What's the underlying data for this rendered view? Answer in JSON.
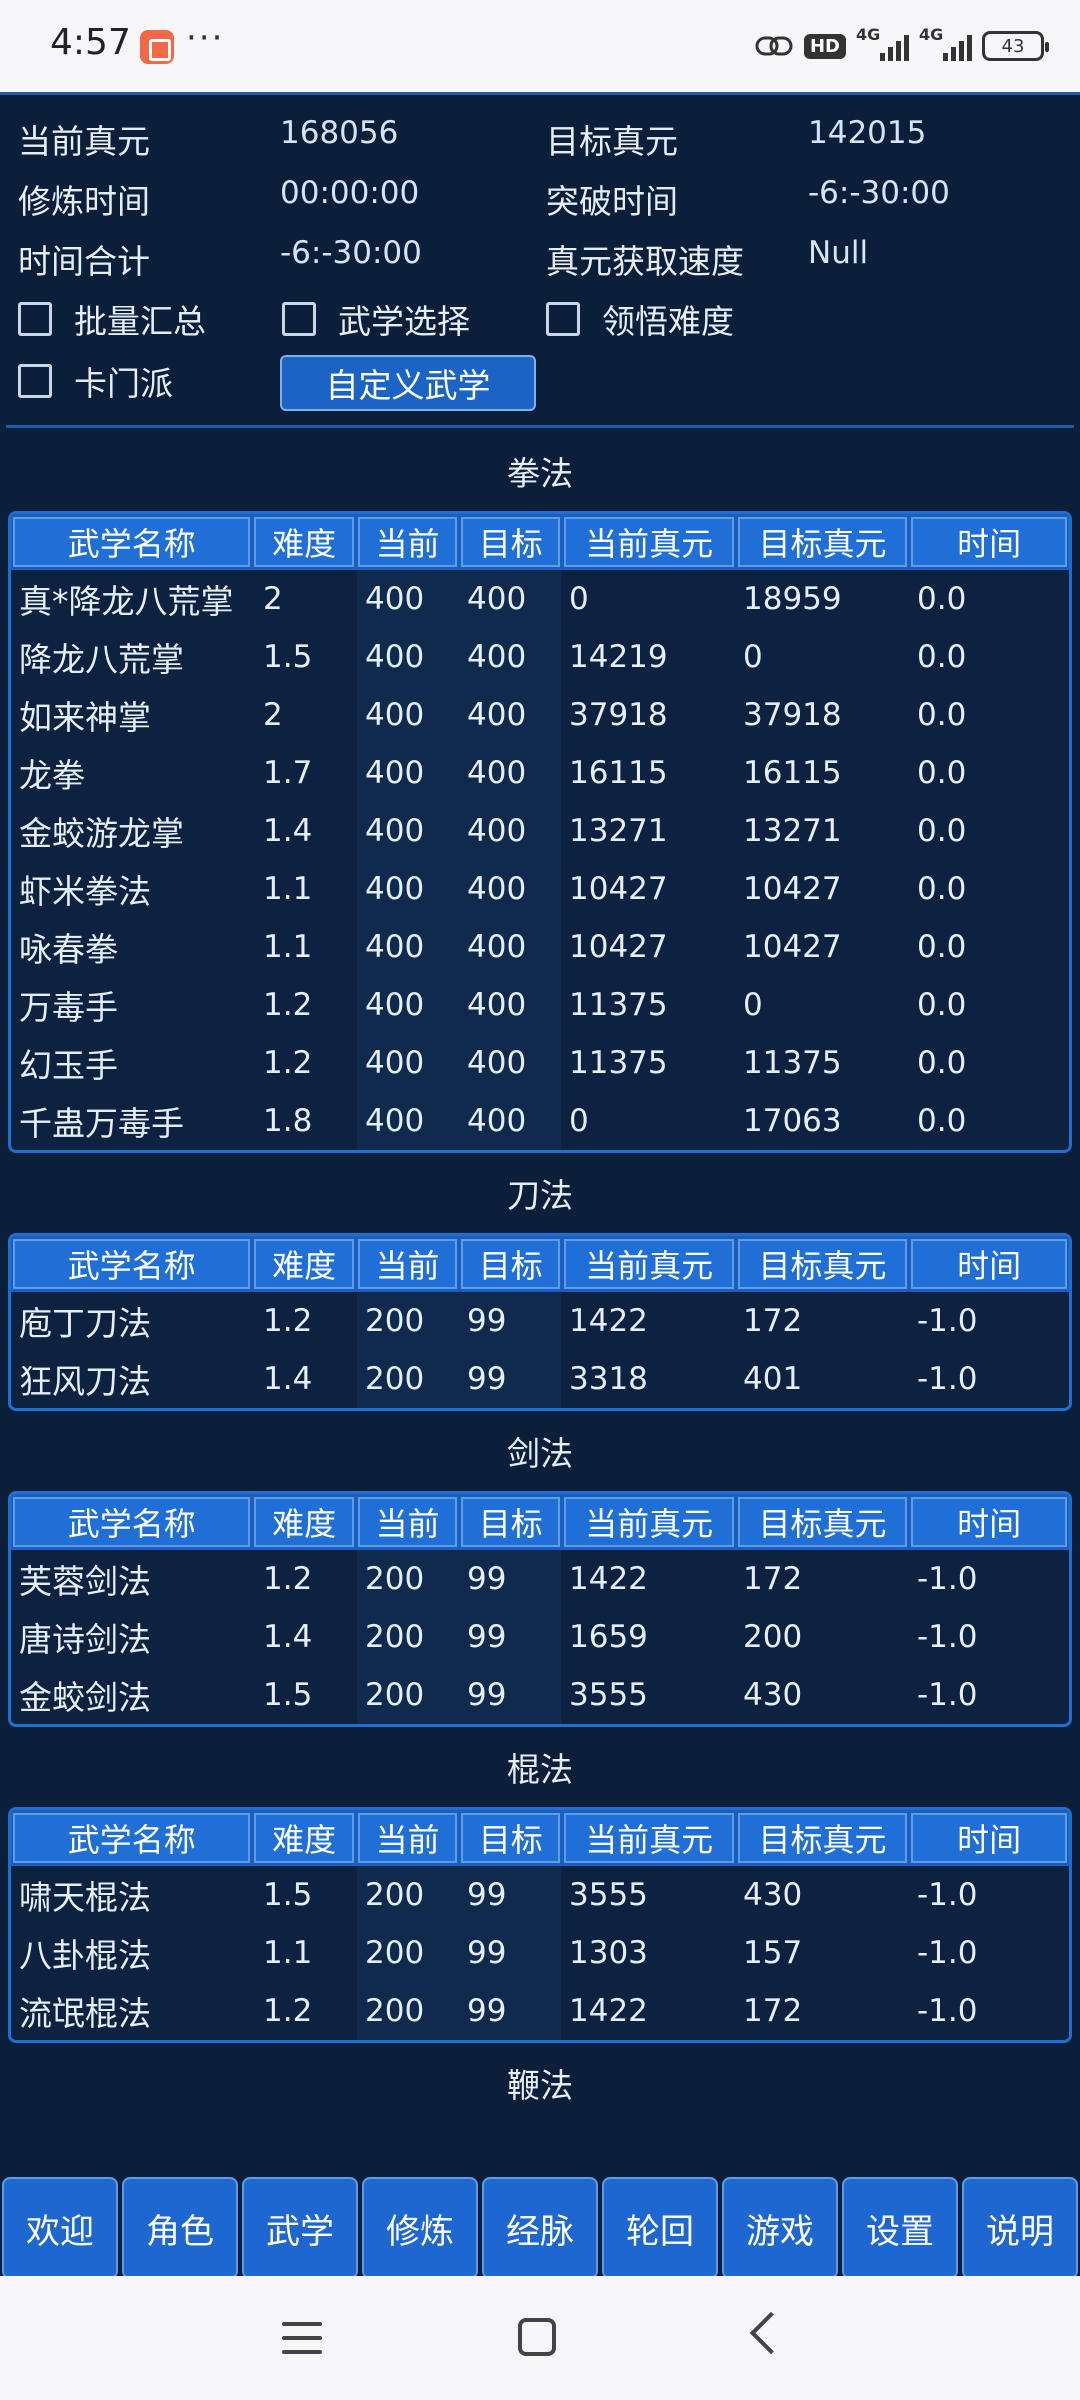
{
  "status": {
    "time": "4:57",
    "dots": "···",
    "hd": "HD",
    "net1": "4G",
    "net2": "4G",
    "battery": "43"
  },
  "summary": {
    "current_zy_label": "当前真元",
    "current_zy_value": "168056",
    "target_zy_label": "目标真元",
    "target_zy_value": "142015",
    "train_time_label": "修炼时间",
    "train_time_value": "00:00:00",
    "break_time_label": "突破时间",
    "break_time_value": "-6:-30:00",
    "total_time_label": "时间合计",
    "total_time_value": "-6:-30:00",
    "speed_label": "真元获取速度",
    "speed_value": "Null"
  },
  "checkboxes": {
    "batch": "批量汇总",
    "martial_select": "武学选择",
    "insight": "领悟难度",
    "sect": "卡门派"
  },
  "custom_button": "自定义武学",
  "headers": {
    "name": "武学名称",
    "difficulty": "难度",
    "current": "当前",
    "target": "目标",
    "cur_zy": "当前真元",
    "tgt_zy": "目标真元",
    "time": "时间"
  },
  "sections": [
    {
      "title": "拳法",
      "rows": [
        [
          "真*降龙八荒掌",
          "2",
          "400",
          "400",
          "0",
          "18959",
          "0.0"
        ],
        [
          "降龙八荒掌",
          "1.5",
          "400",
          "400",
          "14219",
          "0",
          "0.0"
        ],
        [
          "如来神掌",
          "2",
          "400",
          "400",
          "37918",
          "37918",
          "0.0"
        ],
        [
          "龙拳",
          "1.7",
          "400",
          "400",
          "16115",
          "16115",
          "0.0"
        ],
        [
          "金蛟游龙掌",
          "1.4",
          "400",
          "400",
          "13271",
          "13271",
          "0.0"
        ],
        [
          "虾米拳法",
          "1.1",
          "400",
          "400",
          "10427",
          "10427",
          "0.0"
        ],
        [
          "咏春拳",
          "1.1",
          "400",
          "400",
          "10427",
          "10427",
          "0.0"
        ],
        [
          "万毒手",
          "1.2",
          "400",
          "400",
          "11375",
          "0",
          "0.0"
        ],
        [
          "幻玉手",
          "1.2",
          "400",
          "400",
          "11375",
          "11375",
          "0.0"
        ],
        [
          "千蛊万毒手",
          "1.8",
          "400",
          "400",
          "0",
          "17063",
          "0.0"
        ]
      ]
    },
    {
      "title": "刀法",
      "rows": [
        [
          "庖丁刀法",
          "1.2",
          "200",
          "99",
          "1422",
          "172",
          "-1.0"
        ],
        [
          "狂风刀法",
          "1.4",
          "200",
          "99",
          "3318",
          "401",
          "-1.0"
        ]
      ]
    },
    {
      "title": "剑法",
      "rows": [
        [
          "芙蓉剑法",
          "1.2",
          "200",
          "99",
          "1422",
          "172",
          "-1.0"
        ],
        [
          "唐诗剑法",
          "1.4",
          "200",
          "99",
          "1659",
          "200",
          "-1.0"
        ],
        [
          "金蛟剑法",
          "1.5",
          "200",
          "99",
          "3555",
          "430",
          "-1.0"
        ]
      ]
    },
    {
      "title": "棍法",
      "rows": [
        [
          "啸天棍法",
          "1.5",
          "200",
          "99",
          "3555",
          "430",
          "-1.0"
        ],
        [
          "八卦棍法",
          "1.1",
          "200",
          "99",
          "1303",
          "157",
          "-1.0"
        ],
        [
          "流氓棍法",
          "1.2",
          "200",
          "99",
          "1422",
          "172",
          "-1.0"
        ]
      ]
    },
    {
      "title": "鞭法",
      "rows": []
    }
  ],
  "tabs": [
    "欢迎",
    "角色",
    "武学",
    "修炼",
    "经脉",
    "轮回",
    "游戏",
    "设置",
    "说明"
  ]
}
